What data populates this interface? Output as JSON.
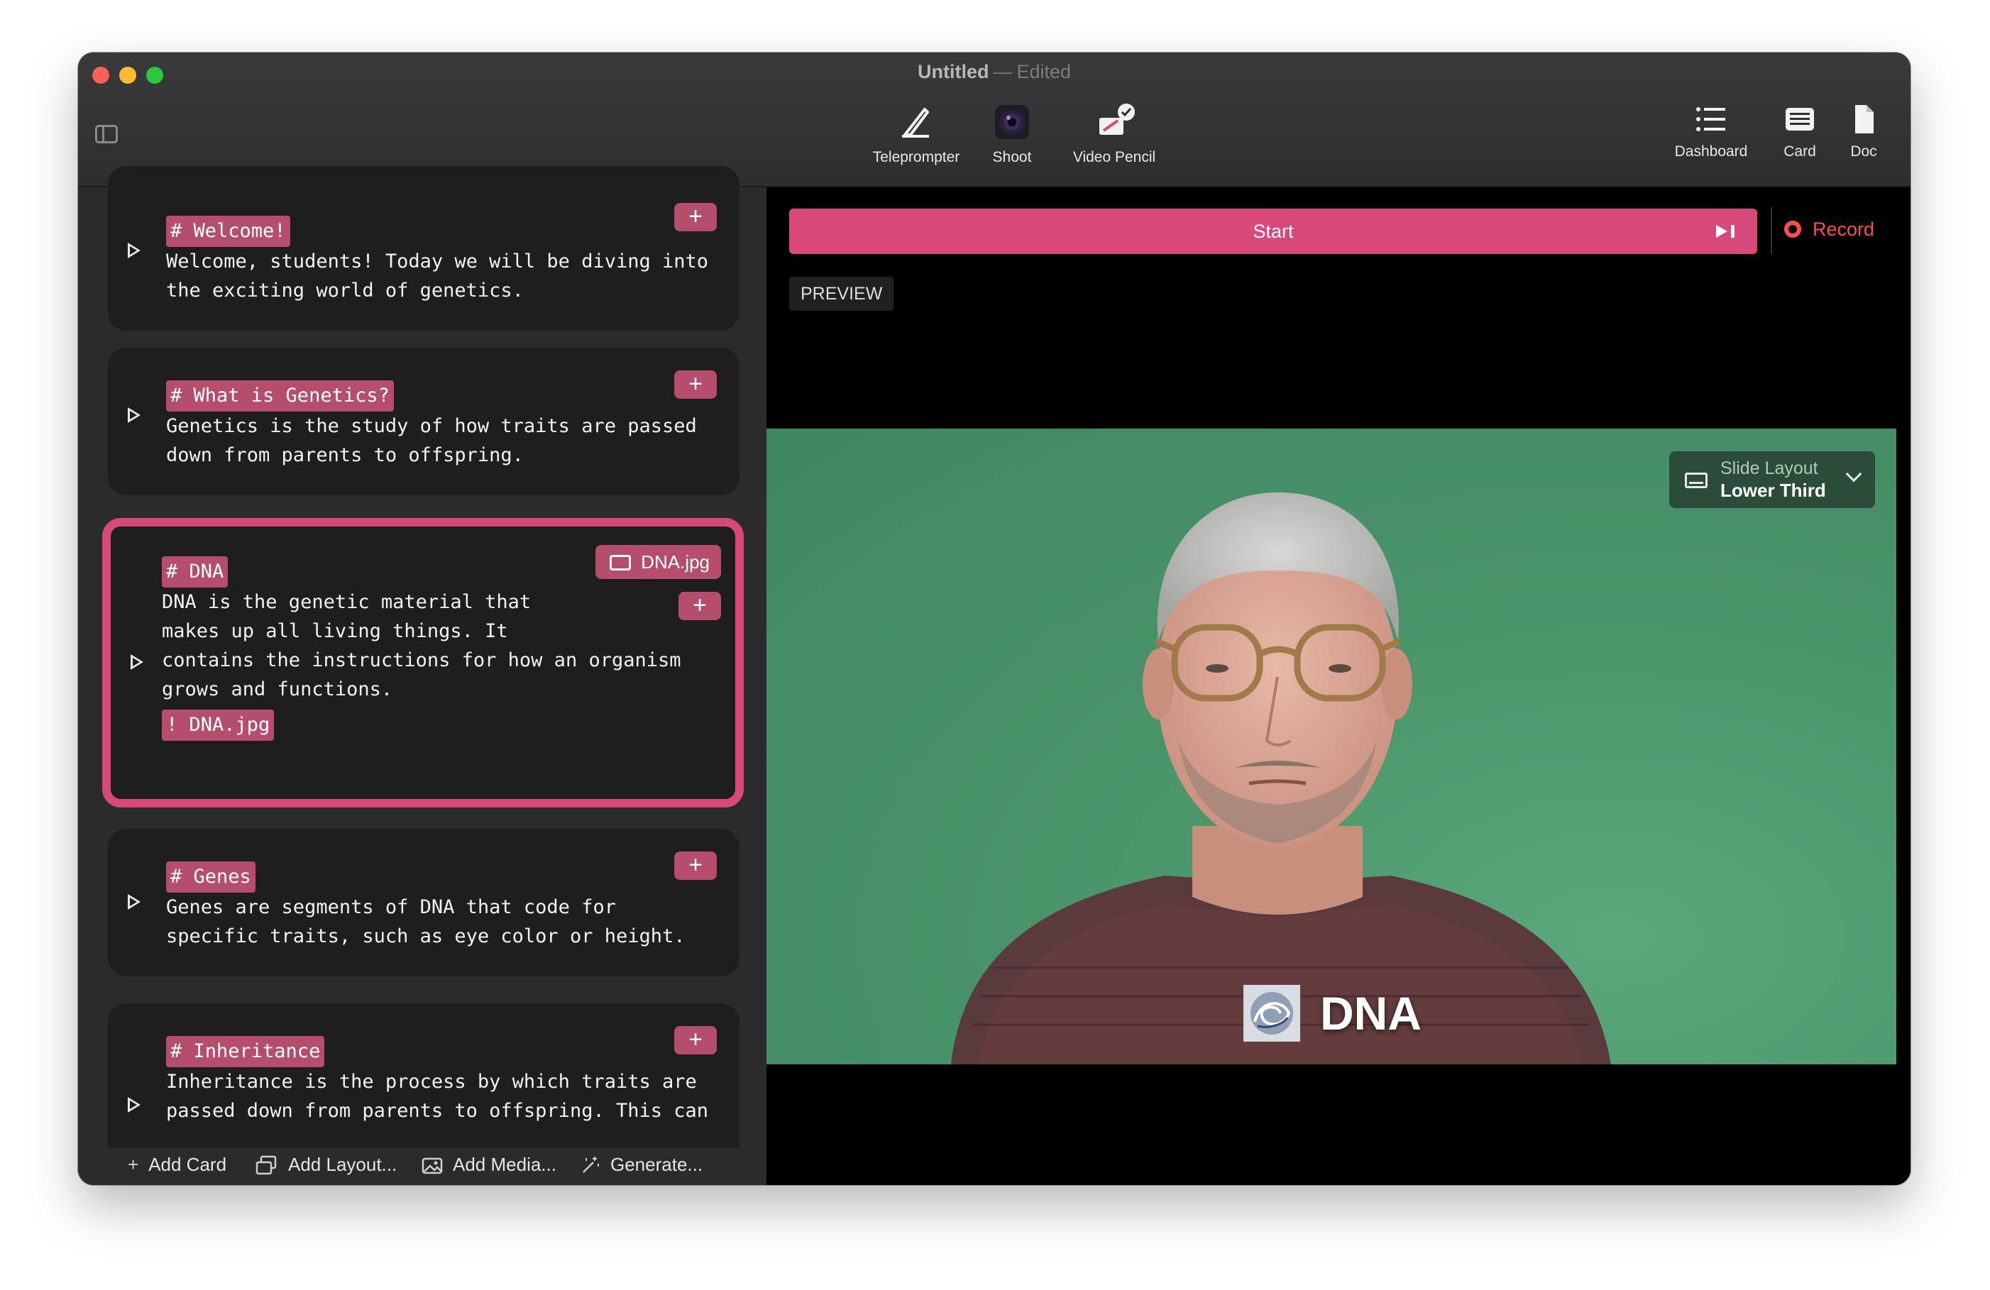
{
  "window": {
    "title": "Untitled",
    "subtitle_sep": "—",
    "status": "Edited"
  },
  "toolbar": {
    "teleprompter": "Teleprompter",
    "shoot": "Shoot",
    "video_pencil": "Video Pencil",
    "dashboard": "Dashboard",
    "card": "Card",
    "doc": "Doc"
  },
  "cards": [
    {
      "heading": "# Welcome!",
      "lines": [
        "Welcome, students! Today we will be diving into",
        "the exciting world of genetics."
      ]
    },
    {
      "heading": "# What is Genetics?",
      "lines": [
        "Genetics is the study of how traits are passed",
        "down from parents to offspring."
      ]
    },
    {
      "heading": "# DNA",
      "lines": [
        "DNA is the genetic material that",
        "makes up all living things. It",
        "contains the instructions for how an organism",
        "grows and functions."
      ],
      "media_tag": "! DNA.jpg",
      "media_chip": "DNA.jpg"
    },
    {
      "heading": "# Genes",
      "lines": [
        "Genes are segments of DNA that code for",
        "specific traits, such as eye color or height."
      ]
    },
    {
      "heading": "# Inheritance",
      "lines": [
        "Inheritance is the process by which traits are",
        "passed down from parents to offspring. This can"
      ]
    }
  ],
  "bottom_bar": {
    "add_card": "Add Card",
    "add_layout": "Add Layout...",
    "add_media": "Add Media...",
    "generate": "Generate..."
  },
  "player": {
    "start": "Start",
    "record": "Record",
    "preview": "PREVIEW",
    "slide_layout_label": "Slide Layout",
    "slide_layout_value": "Lower Third",
    "lower_third_text": "DNA"
  },
  "colors": {
    "accent": "#d6497a",
    "tag": "#b54e6d",
    "record": "#ff4d4d",
    "green_screen": "#4c966c"
  }
}
